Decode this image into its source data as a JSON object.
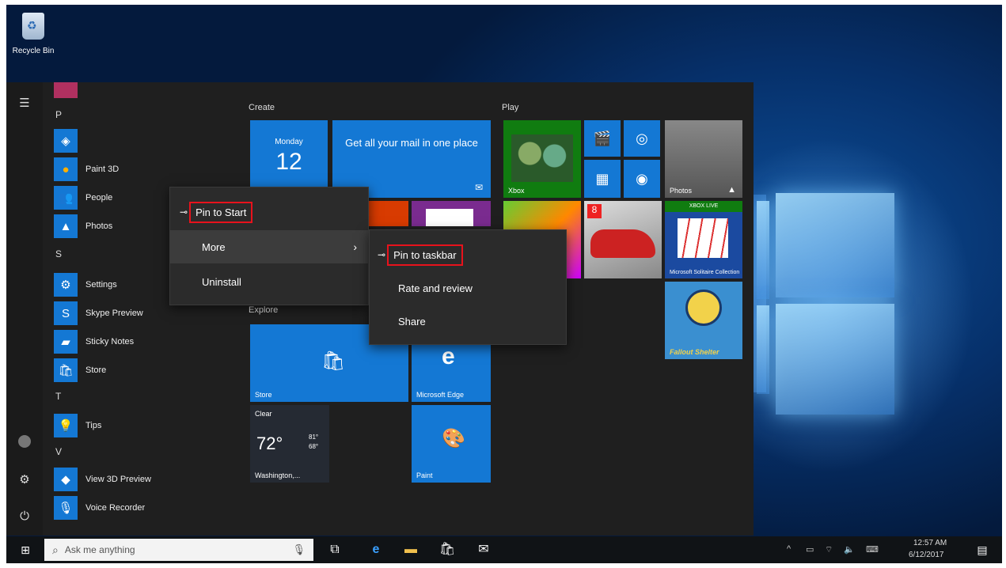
{
  "desktop": {
    "recycle_label": "Recycle Bin"
  },
  "start": {
    "apps": [
      {
        "letter": "P"
      },
      {
        "label": "Paint 3D",
        "icon": "paint-icon"
      },
      {
        "label": "People",
        "icon": "people-icon"
      },
      {
        "label": "Photos",
        "icon": "photos-icon"
      },
      {
        "letter": "S"
      },
      {
        "label": "Settings",
        "icon": "gear-icon"
      },
      {
        "label": "Skype Preview",
        "icon": "skype-icon"
      },
      {
        "label": "Sticky Notes",
        "icon": "sticky-notes-icon"
      },
      {
        "label": "Store",
        "icon": "store-icon"
      },
      {
        "letter": "T"
      },
      {
        "label": "Tips",
        "icon": "tips-icon"
      },
      {
        "letter": "V"
      },
      {
        "label": "View 3D Preview",
        "icon": "view3d-icon"
      },
      {
        "label": "Voice Recorder",
        "icon": "voice-recorder-icon"
      }
    ],
    "groups": {
      "create": "Create",
      "play": "Play",
      "explore": "Explore"
    },
    "tiles": {
      "calendar_day": "Monday",
      "calendar_date": "12",
      "mail_text": "Get all your mail in one place",
      "xbox_name": "Xbox",
      "photos_name": "Photos",
      "xbox_live": "XBOX LIVE",
      "solitaire_name": "Microsoft Solitaire Collection",
      "store_name": "Store",
      "edge_name": "Microsoft Edge",
      "weather_title": "Clear",
      "weather_temp": "72°",
      "weather_hi": "81°",
      "weather_lo": "68°",
      "weather_city": "Washington,...",
      "paint_name": "Paint",
      "fallout_name": "Fallout Shelter"
    }
  },
  "context_menu": {
    "pin_to_start": "Pin to Start",
    "more": "More",
    "uninstall": "Uninstall"
  },
  "submenu": {
    "pin_to_taskbar": "Pin to taskbar",
    "rate_review": "Rate and review",
    "share": "Share"
  },
  "taskbar": {
    "search_placeholder": "Ask me anything",
    "time": "12:57 AM",
    "date": "6/12/2017"
  },
  "colors": {
    "accent": "#1478d4",
    "highlight": "#e8121c",
    "menu_bg": "#1f1f1f"
  }
}
